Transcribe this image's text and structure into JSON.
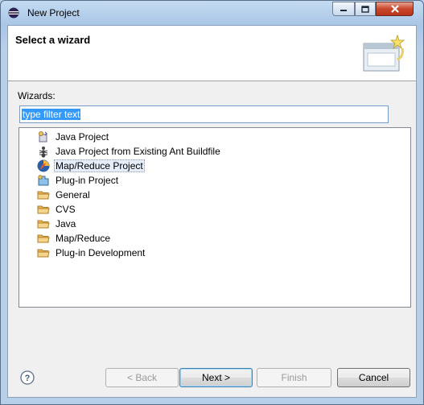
{
  "window": {
    "title": "New Project",
    "icon": "eclipse-icon"
  },
  "banner": {
    "title": "Select a wizard",
    "graphic": "wizard-banner-icon"
  },
  "wizards": {
    "label": "Wizards:",
    "filter_value": "type filter text",
    "items": [
      {
        "label": "Java Project",
        "icon": "java-project-icon",
        "selected": false
      },
      {
        "label": "Java Project from Existing Ant Buildfile",
        "icon": "ant-icon",
        "selected": false
      },
      {
        "label": "Map/Reduce Project",
        "icon": "mapreduce-elephant-icon",
        "selected": true
      },
      {
        "label": "Plug-in Project",
        "icon": "plugin-project-icon",
        "selected": false
      },
      {
        "label": "General",
        "icon": "folder-icon",
        "selected": false
      },
      {
        "label": "CVS",
        "icon": "folder-icon",
        "selected": false
      },
      {
        "label": "Java",
        "icon": "folder-icon",
        "selected": false
      },
      {
        "label": "Map/Reduce",
        "icon": "folder-icon",
        "selected": false
      },
      {
        "label": "Plug-in Development",
        "icon": "folder-icon",
        "selected": false
      }
    ]
  },
  "buttons": {
    "back": "< Back",
    "next": "Next >",
    "finish": "Finish",
    "cancel": "Cancel",
    "help_icon": "help-icon"
  }
}
